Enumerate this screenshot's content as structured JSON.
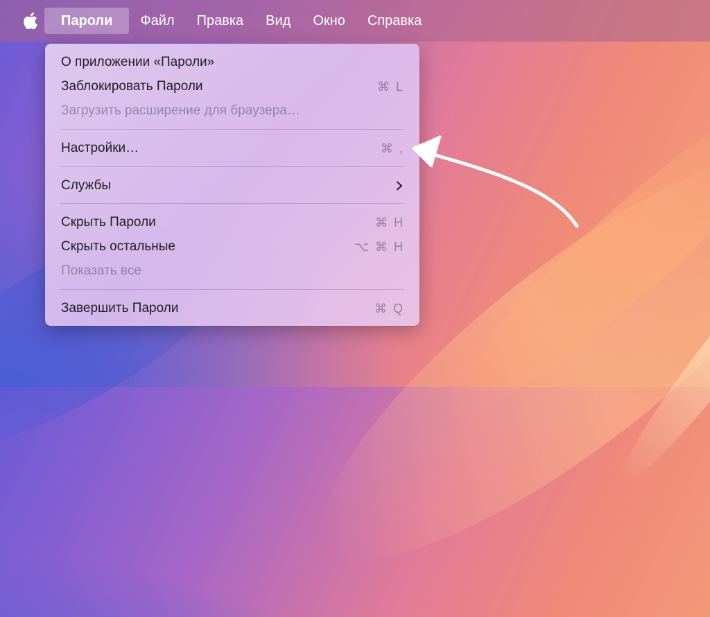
{
  "menubar": {
    "apple_icon": "apple-logo-icon",
    "items": [
      {
        "label": "Пароли",
        "active": true
      },
      {
        "label": "Файл"
      },
      {
        "label": "Правка"
      },
      {
        "label": "Вид"
      },
      {
        "label": "Окно"
      },
      {
        "label": "Справка"
      }
    ]
  },
  "menu": {
    "about": {
      "label": "О приложении «Пароли»"
    },
    "lock": {
      "label": "Заблокировать Пароли",
      "shortcut": "⌘ L"
    },
    "extension": {
      "label": "Загрузить расширение для браузера…",
      "disabled": true
    },
    "settings": {
      "label": "Настройки…",
      "shortcut": "⌘ ,"
    },
    "services": {
      "label": "Службы",
      "submenu_icon": "chevron-right-icon"
    },
    "hide": {
      "label": "Скрыть Пароли",
      "shortcut": "⌘ H"
    },
    "hide_others": {
      "label": "Скрыть остальные",
      "shortcut": "⌥ ⌘ H"
    },
    "show_all": {
      "label": "Показать все",
      "disabled": true
    },
    "quit": {
      "label": "Завершить Пароли",
      "shortcut": "⌘ Q"
    }
  },
  "annotation": {
    "icon": "hand-drawn-arrow-icon",
    "color": "#ffffff"
  }
}
